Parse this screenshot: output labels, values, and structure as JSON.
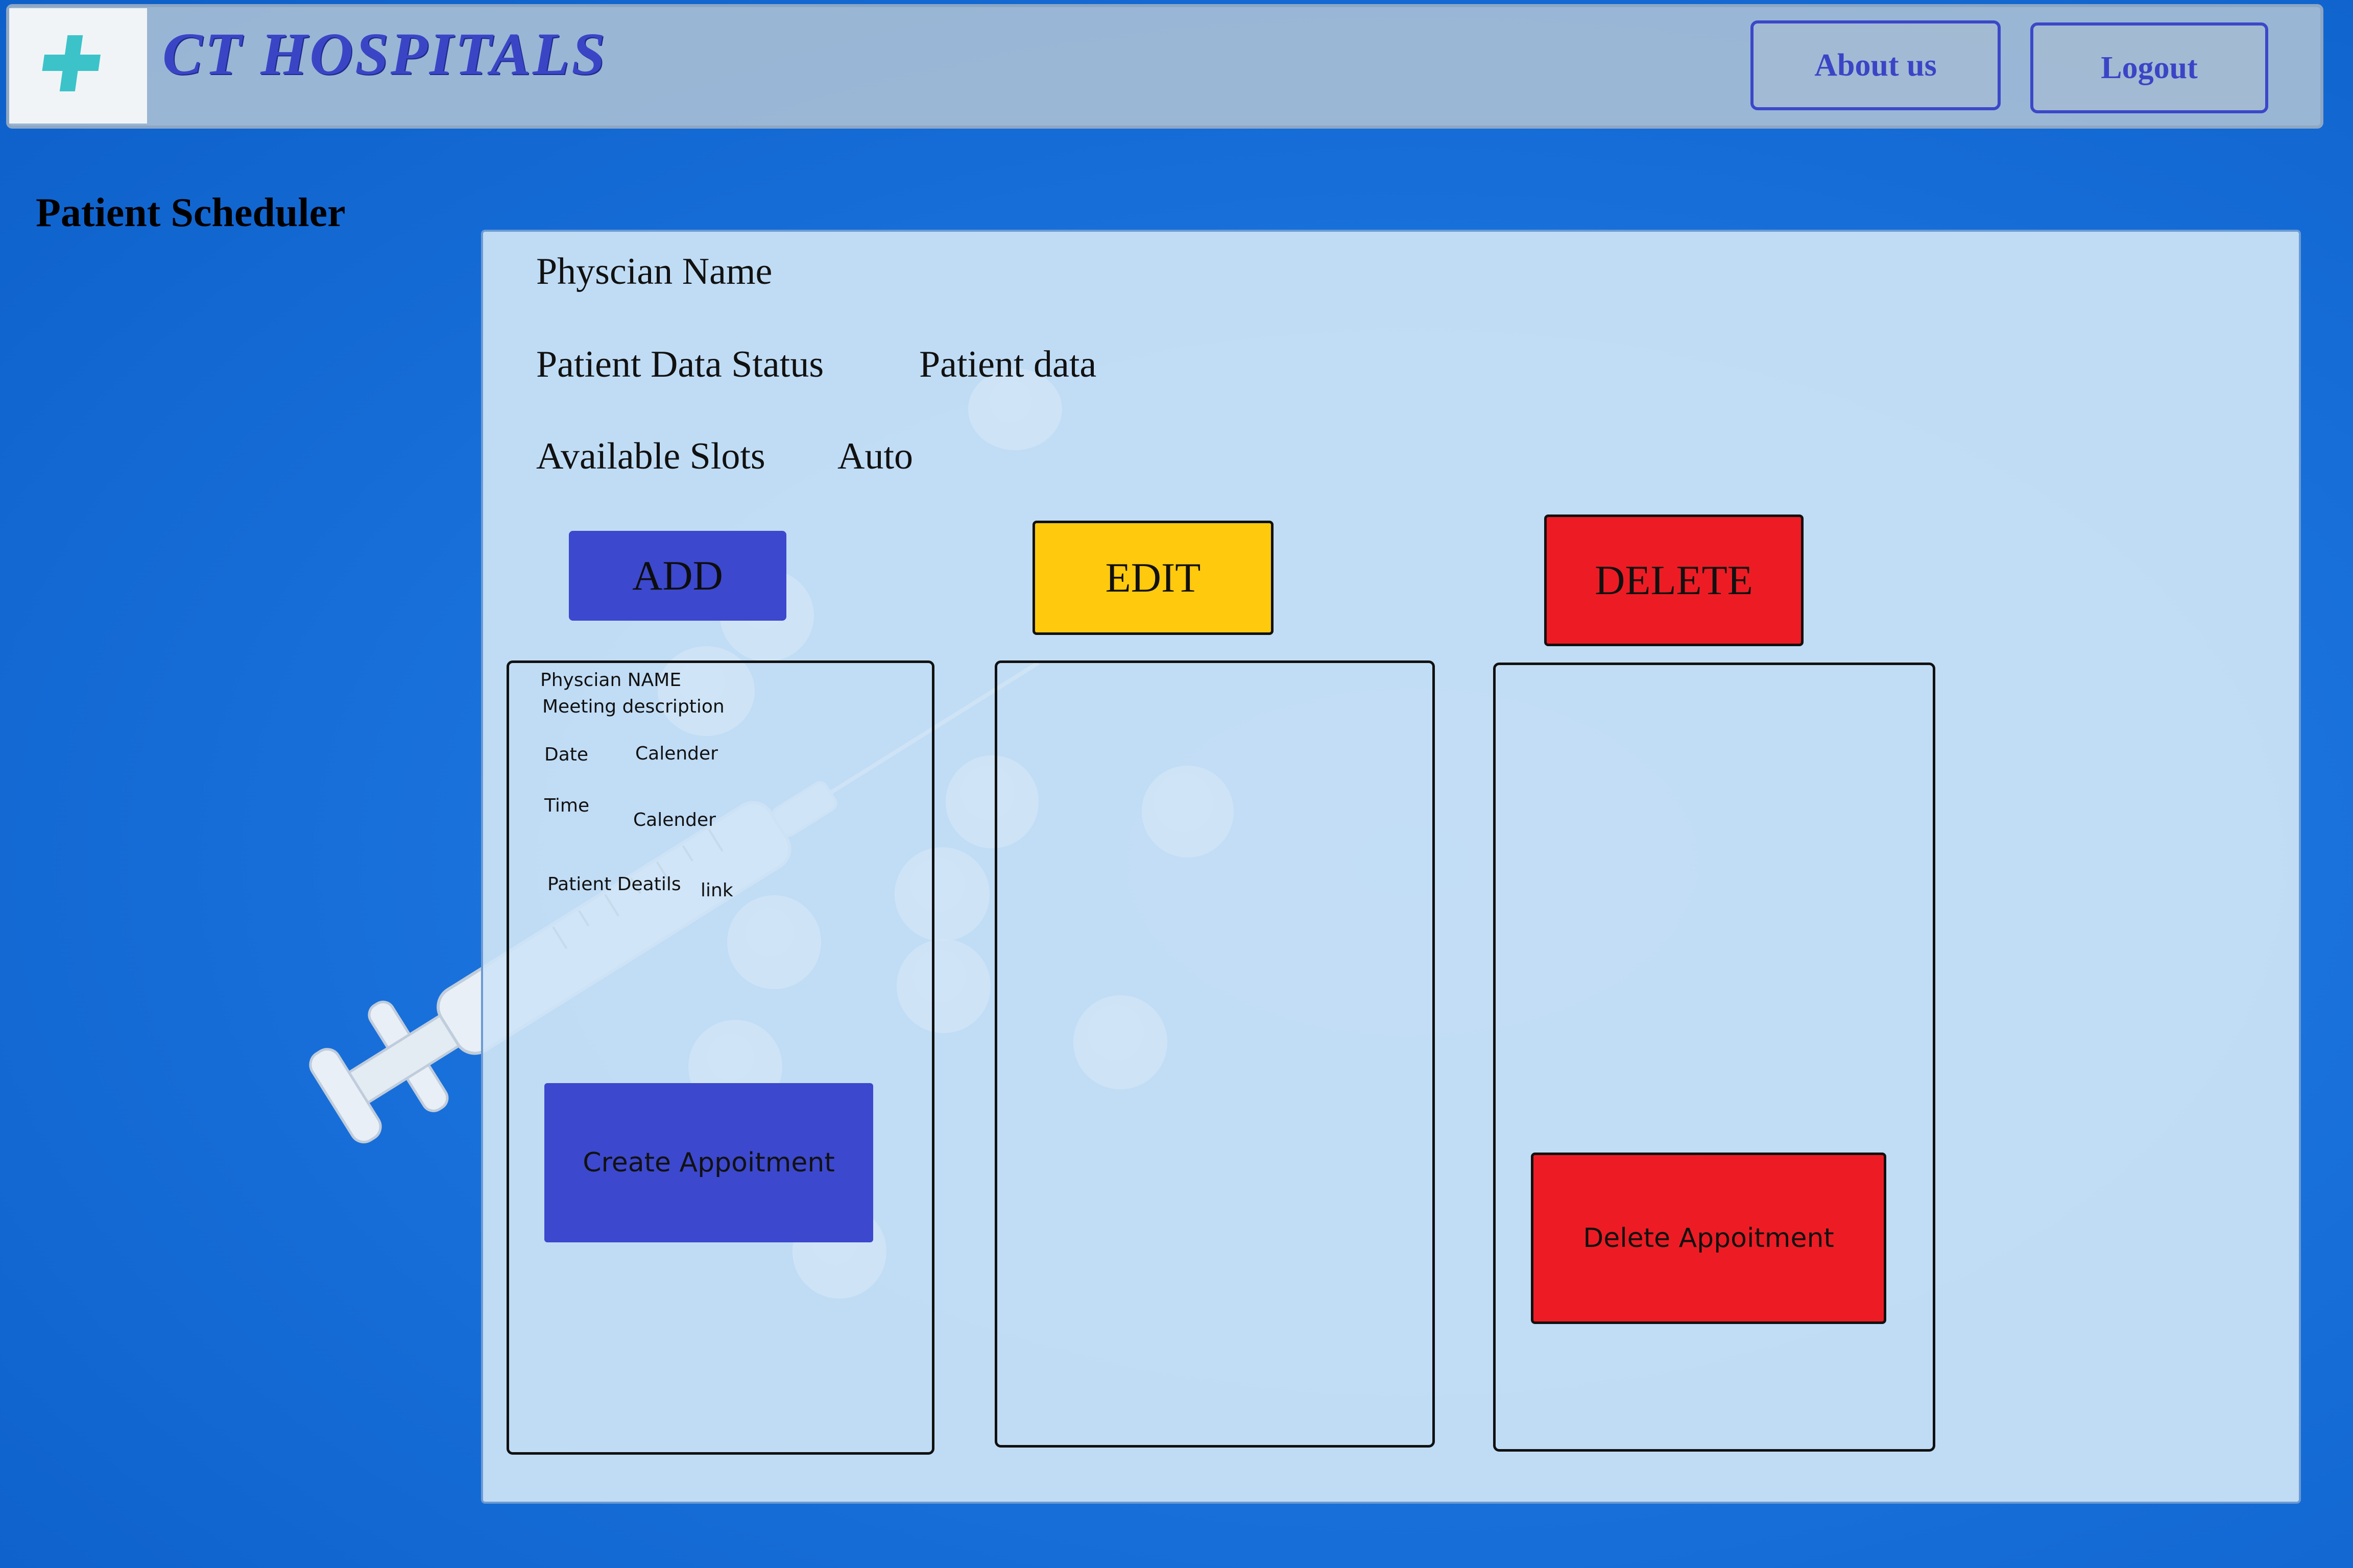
{
  "header": {
    "brand": "CT HOSPITALS",
    "about_label": "About us",
    "logout_label": "Logout"
  },
  "page": {
    "title": "Patient Scheduler"
  },
  "panel": {
    "physician_name_label": "Physcian Name",
    "patient_data_status_label": "Patient Data Status",
    "patient_data_value": "Patient data",
    "available_slots_label": "Available Slots",
    "available_slots_value": "Auto"
  },
  "actions": {
    "add": "ADD",
    "edit": "EDIT",
    "delete": "DELETE"
  },
  "add_form": {
    "physician_name": "Physcian NAME",
    "meeting_description": "Meeting description",
    "date_label": "Date",
    "date_value": "Calender",
    "time_label": "Time",
    "time_value": "Calender",
    "patient_details_label": "Patient Deatils",
    "patient_details_value": "link",
    "create_button": "Create Appoitment"
  },
  "delete_form": {
    "delete_button": "Delete Appoitment"
  },
  "colors": {
    "brand": "#3a45c6",
    "add": "#3c48cd",
    "edit": "#ffc90e",
    "delete": "#ed1c24",
    "background": "#1a72dc"
  }
}
